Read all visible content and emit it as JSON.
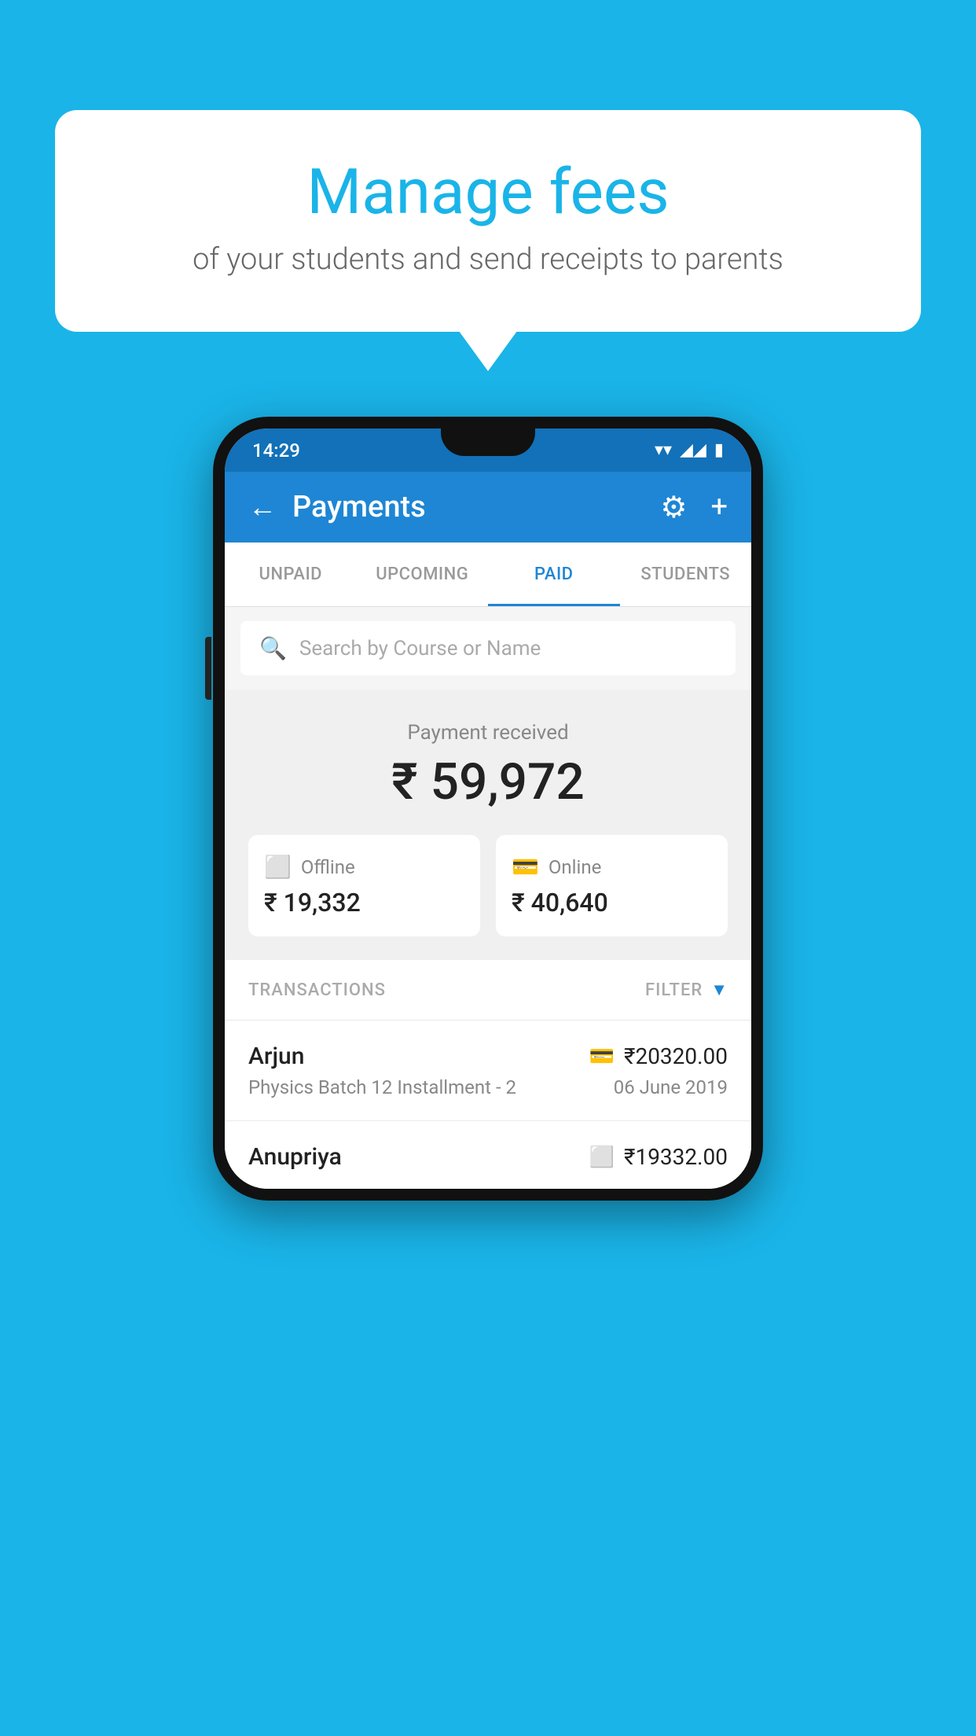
{
  "background_color": "#1ab4e8",
  "speech_bubble": {
    "title": "Manage fees",
    "subtitle": "of your students and send receipts to parents"
  },
  "status_bar": {
    "time": "14:29",
    "wifi": "▼",
    "signal": "▲",
    "battery": "▮"
  },
  "app_bar": {
    "title": "Payments",
    "back_label": "←",
    "gear_label": "⚙",
    "plus_label": "+"
  },
  "tabs": [
    {
      "id": "unpaid",
      "label": "UNPAID",
      "active": false
    },
    {
      "id": "upcoming",
      "label": "UPCOMING",
      "active": false
    },
    {
      "id": "paid",
      "label": "PAID",
      "active": true
    },
    {
      "id": "students",
      "label": "STUDENTS",
      "active": false
    }
  ],
  "search": {
    "placeholder": "Search by Course or Name"
  },
  "payment_summary": {
    "label": "Payment received",
    "total": "₹ 59,972",
    "offline_label": "Offline",
    "offline_amount": "₹ 19,332",
    "online_label": "Online",
    "online_amount": "₹ 40,640"
  },
  "transactions": {
    "header_label": "TRANSACTIONS",
    "filter_label": "FILTER",
    "rows": [
      {
        "name": "Arjun",
        "course": "Physics Batch 12 Installment - 2",
        "date": "06 June 2019",
        "amount": "₹20320.00",
        "payment_type": "online"
      },
      {
        "name": "Anupriya",
        "course": "",
        "date": "",
        "amount": "₹19332.00",
        "payment_type": "offline"
      }
    ]
  }
}
